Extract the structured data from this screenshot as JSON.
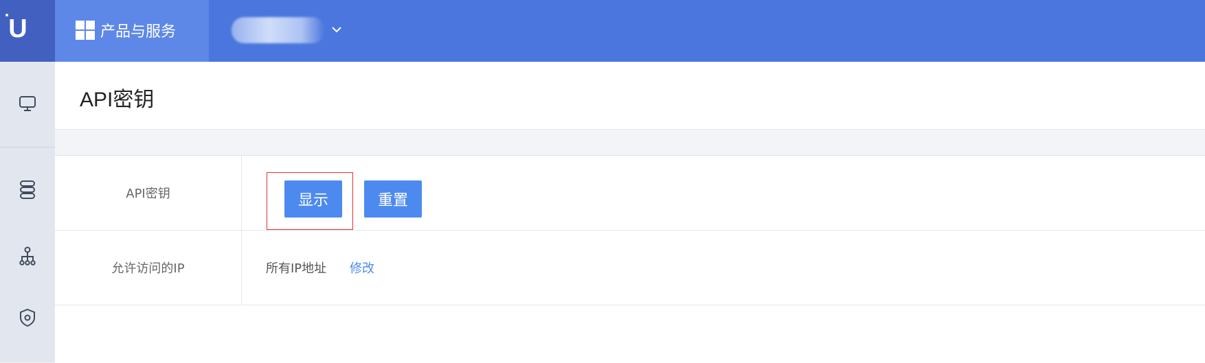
{
  "topbar": {
    "logo_letter": "U",
    "products_label": "产品与服务"
  },
  "page": {
    "title": "API密钥"
  },
  "settings": {
    "rows": [
      {
        "label": "API密钥",
        "buttons": {
          "show": "显示",
          "reset": "重置"
        }
      },
      {
        "label": "允许访问的IP",
        "value": "所有IP地址",
        "action": "修改"
      }
    ]
  },
  "colors": {
    "topbar": "#4b76de",
    "logo_bg": "#4260bf",
    "products_bg": "#5d88e8",
    "primary_button": "#4c8af0",
    "link": "#4c8af0",
    "highlight_border": "#e03030",
    "sidebar_bg": "#e2e6ef"
  },
  "sidebar": {
    "icons": [
      "monitor-icon",
      "database-icon",
      "network-icon",
      "shield-settings-icon"
    ]
  }
}
